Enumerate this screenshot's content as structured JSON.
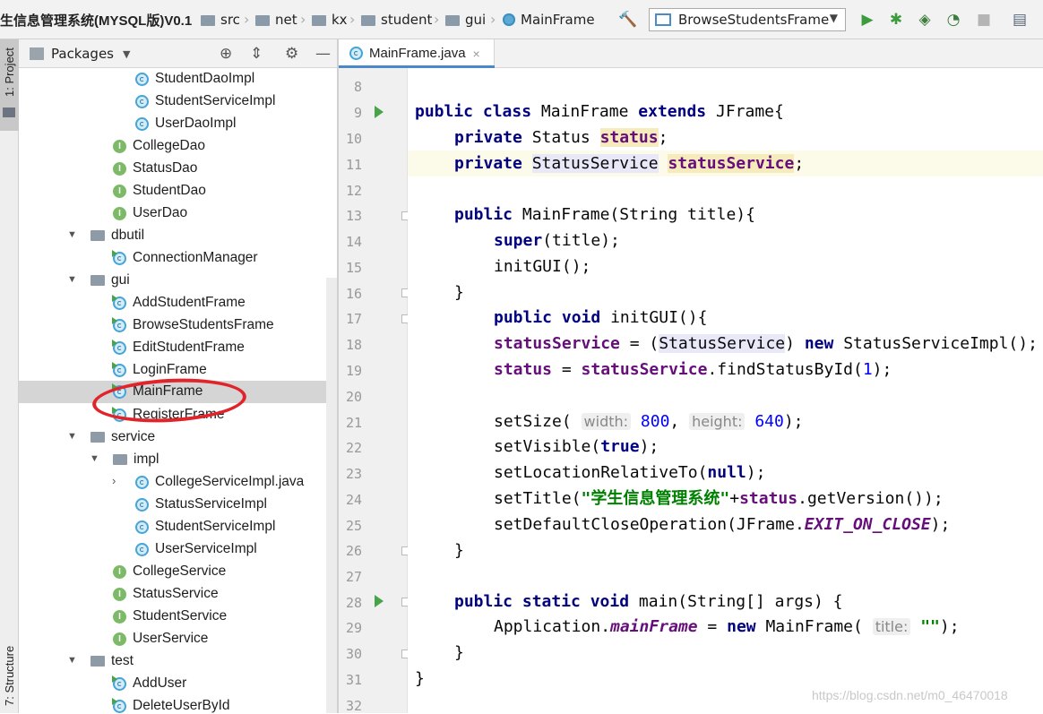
{
  "navbar": {
    "title": "生信息管理系统(MYSQL版)V0.1",
    "breadcrumbs": [
      "src",
      "net",
      "kx",
      "student",
      "gui",
      "MainFrame"
    ],
    "run_config": "BrowseStudentsFrame"
  },
  "left_strip": {
    "project_tab": "1: Project",
    "structure_tab": "7: Structure"
  },
  "panel": {
    "view_label": "Packages"
  },
  "tree": [
    {
      "label": "StudentDaoImpl",
      "icon": "class-icon"
    },
    {
      "label": "StudentServiceImpl",
      "icon": "class-icon"
    },
    {
      "label": "UserDaoImpl",
      "icon": "class-icon"
    },
    {
      "label": "CollegeDao",
      "icon": "interface-icon"
    },
    {
      "label": "StatusDao",
      "icon": "interface-icon"
    },
    {
      "label": "StudentDao",
      "icon": "interface-icon"
    },
    {
      "label": "UserDao",
      "icon": "interface-icon"
    },
    {
      "label": "dbutil",
      "icon": "package-icon"
    },
    {
      "label": "ConnectionManager",
      "icon": "class-icon"
    },
    {
      "label": "gui",
      "icon": "package-icon"
    },
    {
      "label": "AddStudentFrame",
      "icon": "runnable-class-icon"
    },
    {
      "label": "BrowseStudentsFrame",
      "icon": "runnable-class-icon"
    },
    {
      "label": "EditStudentFrame",
      "icon": "runnable-class-icon"
    },
    {
      "label": "LoginFrame",
      "icon": "runnable-class-icon"
    },
    {
      "label": "MainFrame",
      "icon": "runnable-class-icon",
      "selected": true
    },
    {
      "label": "RegisterFrame",
      "icon": "runnable-class-icon"
    },
    {
      "label": "service",
      "icon": "package-icon"
    },
    {
      "label": "impl",
      "icon": "package-icon"
    },
    {
      "label": "CollegeServiceImpl.java",
      "icon": "class-icon"
    },
    {
      "label": "StatusServiceImpl",
      "icon": "class-icon"
    },
    {
      "label": "StudentServiceImpl",
      "icon": "class-icon"
    },
    {
      "label": "UserServiceImpl",
      "icon": "class-icon"
    },
    {
      "label": "CollegeService",
      "icon": "interface-icon"
    },
    {
      "label": "StatusService",
      "icon": "interface-icon"
    },
    {
      "label": "StudentService",
      "icon": "interface-icon"
    },
    {
      "label": "UserService",
      "icon": "interface-icon"
    },
    {
      "label": "test",
      "icon": "package-icon"
    },
    {
      "label": "AddUser",
      "icon": "runnable-class-icon"
    },
    {
      "label": "DeleteUserById",
      "icon": "runnable-class-icon"
    }
  ],
  "editor": {
    "tab_label": "MainFrame.java",
    "close_glyph": "×",
    "line_numbers": [
      "8",
      "9",
      "10",
      "11",
      "12",
      "13",
      "14",
      "15",
      "16",
      "17",
      "18",
      "19",
      "20",
      "21",
      "22",
      "23",
      "24",
      "25",
      "26",
      "27",
      "28",
      "29",
      "30",
      "31",
      "32"
    ],
    "code": {
      "l9_kw": "public class",
      "l9_name": "MainFrame",
      "l9_kw2": "extends",
      "l9_rest": "JFrame{",
      "l10_kw": "private",
      "l10_type": "Status",
      "l10_field": "status",
      "l11_kw": "private",
      "l11_type": "StatusService",
      "l11_field": "statusService",
      "l13_kw": "public",
      "l13_rest": "MainFrame(String title){",
      "l14_kw": "super",
      "l14_rest": "(title);",
      "l15": "initGUI();",
      "l16": "}",
      "l17_kw": "public void",
      "l17_rest": "initGUI(){",
      "l18_field": "statusService",
      "l18_cast": "StatusService",
      "l18_kw": "new",
      "l18_rest": "StatusServiceImpl();",
      "l19_field": "status",
      "l19_field2": "statusService",
      "l19_method": ".findStatusById(",
      "l19_num": "1",
      "l19_end": ");",
      "l21_pre": "setSize(",
      "l21_hint1": "width:",
      "l21_num1": "800",
      "l21_hint2": "height:",
      "l21_num2": "640",
      "l21_end": ");",
      "l22_pre": "setVisible(",
      "l22_kw": "true",
      "l22_end": ");",
      "l23_pre": "setLocationRelativeTo(",
      "l23_kw": "null",
      "l23_end": ");",
      "l24_pre": "setTitle(",
      "l24_str": "\"学生信息管理系统\"",
      "l24_plus": "+",
      "l24_field": "status",
      "l24_end": ".getVersion());",
      "l25_pre": "setDefaultCloseOperation(JFrame.",
      "l25_const": "EXIT_ON_CLOSE",
      "l25_end": ");",
      "l26": "}",
      "l28_kw": "public static void",
      "l28_rest": "main(String[] args) {",
      "l29_pre": "Application.",
      "l29_field": "mainFrame",
      "l29_eq": " = ",
      "l29_kw": "new",
      "l29_mid": " MainFrame(",
      "l29_hint": "title:",
      "l29_str": "\"\"",
      "l29_end": ");",
      "l30": "}",
      "l31": "}"
    }
  },
  "watermark": "https://blog.csdn.net/m0_46470018",
  "colors": {
    "keyword": "#000080",
    "field": "#660e7a",
    "string": "#008000",
    "number": "#0000ff",
    "annotation_circle": "#e0242a"
  }
}
